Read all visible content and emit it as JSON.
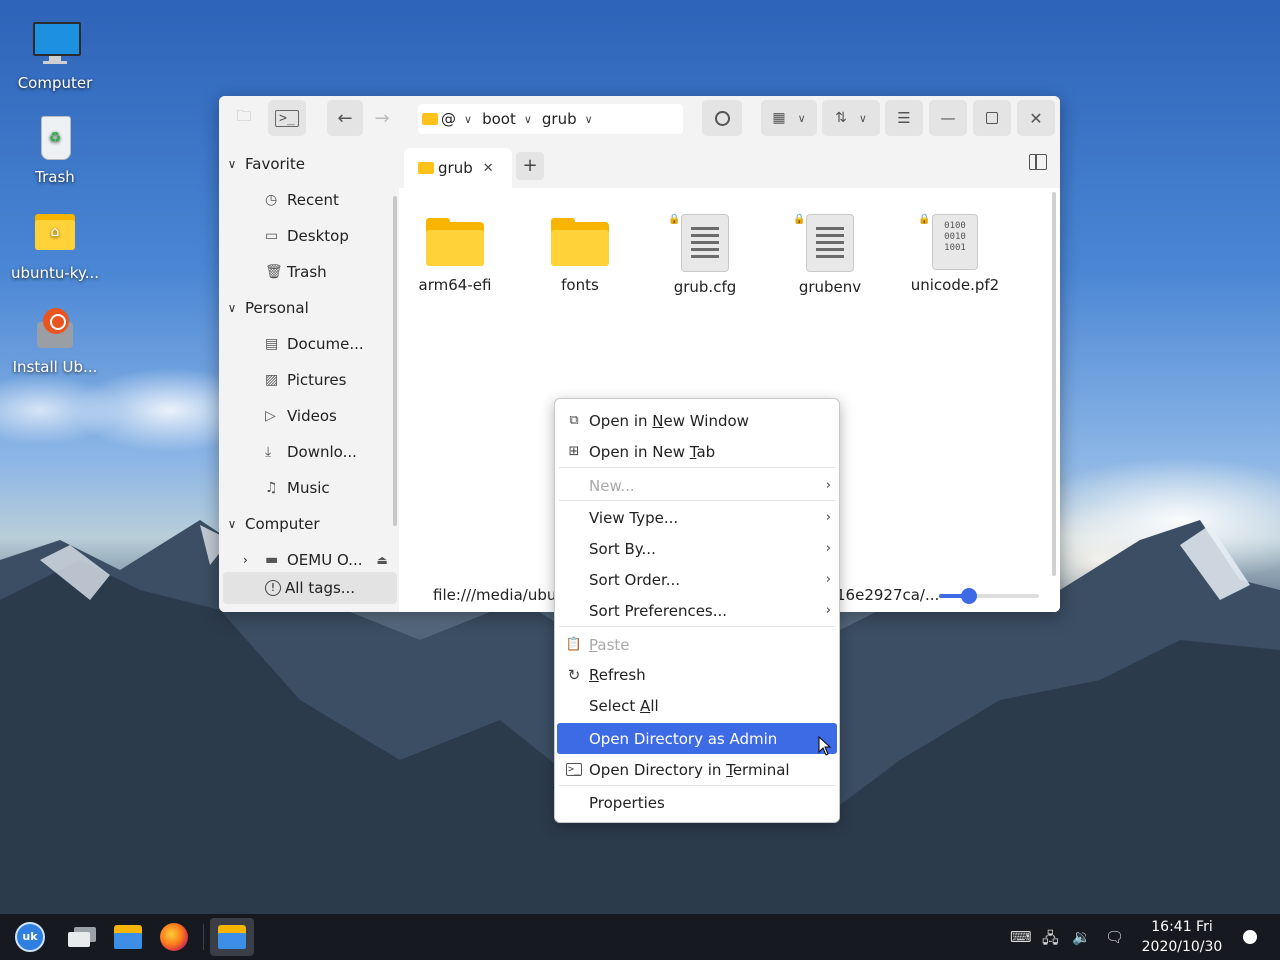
{
  "desktop": {
    "icons": [
      {
        "label": "Computer"
      },
      {
        "label": "Trash"
      },
      {
        "label": "ubuntu-ky..."
      },
      {
        "label": "Install Ub..."
      }
    ]
  },
  "window": {
    "path": [
      "@",
      "boot",
      "grub"
    ],
    "sidebar": {
      "favorite": "Favorite",
      "recent": "Recent",
      "desktop": "Desktop",
      "trash": "Trash",
      "personal": "Personal",
      "documents": "Docume...",
      "pictures": "Pictures",
      "videos": "Videos",
      "downloads": "Downlo...",
      "music": "Music",
      "computer": "Computer",
      "drive": "OEMU O...",
      "all_tags": "All tags..."
    },
    "tab": {
      "label": "grub",
      "add": "+"
    },
    "files": [
      {
        "name": "arm64-efi",
        "kind": "folder"
      },
      {
        "name": "fonts",
        "kind": "folder"
      },
      {
        "name": "grub.cfg",
        "kind": "text"
      },
      {
        "name": "grubenv",
        "kind": "text"
      },
      {
        "name": "unicode.pf2",
        "kind": "binary"
      }
    ],
    "binary_glyph": [
      "0100",
      "0010",
      "1001"
    ],
    "status": {
      "left": "file:///media/ubu",
      "right": "16e2927ca/..."
    },
    "zoom_fraction": 0.3
  },
  "menu": {
    "items": {
      "new_window": {
        "pre": "Open in ",
        "acc": "N",
        "post": "ew Window"
      },
      "new_tab": {
        "pre": "Open in New ",
        "acc": "T",
        "post": "ab"
      },
      "new": "New...",
      "view_type": "View Type...",
      "sort_by": "Sort By...",
      "sort_order": "Sort Order...",
      "sort_prefs": "Sort Preferences...",
      "paste": {
        "pre": "",
        "acc": "P",
        "post": "aste"
      },
      "refresh": {
        "pre": "",
        "acc": "R",
        "post": "efresh"
      },
      "select_all": {
        "pre": "Select ",
        "acc": "A",
        "post": "ll"
      },
      "admin": "Open Directory as Admin",
      "terminal": {
        "pre": "Open Directory in ",
        "acc": "T",
        "post": "erminal"
      },
      "properties": "Properties"
    }
  },
  "taskbar": {
    "clock_time": "16:41 Fri",
    "clock_date": "2020/10/30"
  },
  "colors": {
    "accent": "#3d6be5",
    "folder": "#ffd23a",
    "taskbar": "#161a20"
  }
}
